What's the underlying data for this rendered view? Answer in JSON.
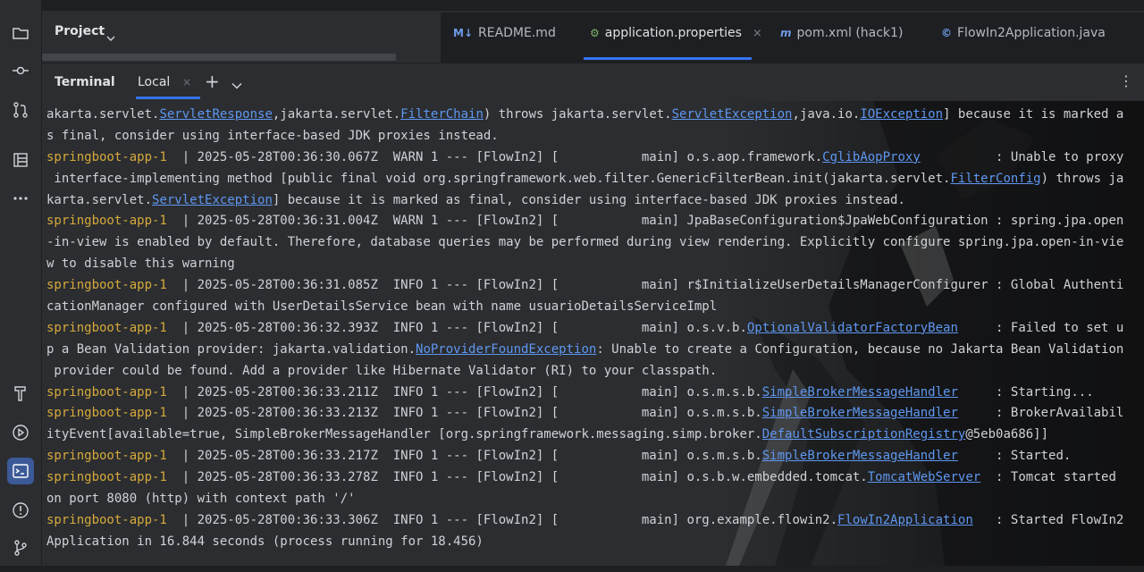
{
  "project": {
    "title": "Project"
  },
  "tabs": [
    {
      "icon": "M↓",
      "label": "README.md"
    },
    {
      "icon": "⚙",
      "label": "application.properties"
    },
    {
      "icon": "m",
      "label": "pom.xml (hack1)"
    },
    {
      "icon": "©",
      "label": "FlowIn2Application.java"
    }
  ],
  "terminal": {
    "title": "Terminal",
    "tab": "Local"
  },
  "log": [
    [
      {
        "t": "akarta.servlet."
      },
      {
        "t": "ServletResponse",
        "k": "lnk"
      },
      {
        "t": ",jakarta.servlet."
      },
      {
        "t": "FilterChain",
        "k": "lnk"
      },
      {
        "t": ") throws jakarta.servlet."
      },
      {
        "t": "ServletException",
        "k": "lnk"
      },
      {
        "t": ",java.io."
      },
      {
        "t": "IOException",
        "k": "lnk"
      },
      {
        "t": "] because it is marked a"
      }
    ],
    [
      {
        "t": "s final, consider using interface-based JDK proxies instead."
      }
    ],
    [
      {
        "t": "springboot-app-1 ",
        "k": "app"
      },
      {
        "t": " | 2025-05-28T00:36:30.067Z  WARN 1 --- [FlowIn2] [           main] o.s.aop.framework."
      },
      {
        "t": "CglibAopProxy",
        "k": "lnk"
      },
      {
        "t": "          : Unable to proxy"
      }
    ],
    [
      {
        "t": " interface-implementing method [public final void org.springframework.web.filter.GenericFilterBean.init(jakarta.servlet."
      },
      {
        "t": "FilterConfig",
        "k": "lnk"
      },
      {
        "t": ") throws ja"
      }
    ],
    [
      {
        "t": "karta.servlet."
      },
      {
        "t": "ServletException",
        "k": "lnk"
      },
      {
        "t": "] because it is marked as final, consider using interface-based JDK proxies instead."
      }
    ],
    [
      {
        "t": "springboot-app-1 ",
        "k": "app"
      },
      {
        "t": " | 2025-05-28T00:36:31.004Z  WARN 1 --- [FlowIn2] [           main] JpaBaseConfiguration$JpaWebConfiguration : spring.jpa.open"
      }
    ],
    [
      {
        "t": "-in-view is enabled by default. Therefore, database queries may be performed during view rendering. Explicitly configure spring.jpa.open-in-vie"
      }
    ],
    [
      {
        "t": "w to disable this warning"
      }
    ],
    [
      {
        "t": "springboot-app-1 ",
        "k": "app"
      },
      {
        "t": " | 2025-05-28T00:36:31.085Z  INFO 1 --- [FlowIn2] [           main] r$InitializeUserDetailsManagerConfigurer : Global Authenti"
      }
    ],
    [
      {
        "t": "cationManager configured with UserDetailsService bean with name usuarioDetailsServiceImpl"
      }
    ],
    [
      {
        "t": "springboot-app-1 ",
        "k": "app"
      },
      {
        "t": " | 2025-05-28T00:36:32.393Z  INFO 1 --- [FlowIn2] [           main] o.s.v.b."
      },
      {
        "t": "OptionalValidatorFactoryBean",
        "k": "lnk"
      },
      {
        "t": "     : Failed to set u"
      }
    ],
    [
      {
        "t": "p a Bean Validation provider: jakarta.validation."
      },
      {
        "t": "NoProviderFoundException",
        "k": "lnk"
      },
      {
        "t": ": Unable to create a Configuration, because no Jakarta Bean Validation"
      }
    ],
    [
      {
        "t": " provider could be found. Add a provider like Hibernate Validator (RI) to your classpath."
      }
    ],
    [
      {
        "t": "springboot-app-1 ",
        "k": "app"
      },
      {
        "t": " | 2025-05-28T00:36:33.211Z  INFO 1 --- [FlowIn2] [           main] o.s.m.s.b."
      },
      {
        "t": "SimpleBrokerMessageHandler",
        "k": "lnk"
      },
      {
        "t": "     : Starting..."
      }
    ],
    [
      {
        "t": "springboot-app-1 ",
        "k": "app"
      },
      {
        "t": " | 2025-05-28T00:36:33.213Z  INFO 1 --- [FlowIn2] [           main] o.s.m.s.b."
      },
      {
        "t": "SimpleBrokerMessageHandler",
        "k": "lnk"
      },
      {
        "t": "     : BrokerAvailabil"
      }
    ],
    [
      {
        "t": "ityEvent[available=true, SimpleBrokerMessageHandler [org.springframework.messaging.simp.broker."
      },
      {
        "t": "DefaultSubscriptionRegistry",
        "k": "lnk"
      },
      {
        "t": "@5eb0a686]]"
      }
    ],
    [
      {
        "t": "springboot-app-1 ",
        "k": "app"
      },
      {
        "t": " | 2025-05-28T00:36:33.217Z  INFO 1 --- [FlowIn2] [           main] o.s.m.s.b."
      },
      {
        "t": "SimpleBrokerMessageHandler",
        "k": "lnk"
      },
      {
        "t": "     : Started."
      }
    ],
    [
      {
        "t": "springboot-app-1 ",
        "k": "app"
      },
      {
        "t": " | 2025-05-28T00:36:33.278Z  INFO 1 --- [FlowIn2] [           main] o.s.b.w.embedded.tomcat."
      },
      {
        "t": "TomcatWebServer",
        "k": "lnk"
      },
      {
        "t": "  : Tomcat started"
      }
    ],
    [
      {
        "t": "on port 8080 (http) with context path '/'"
      }
    ],
    [
      {
        "t": "springboot-app-1 ",
        "k": "app"
      },
      {
        "t": " | 2025-05-28T00:36:33.306Z  INFO 1 --- [FlowIn2] [           main] org.example.flowin2."
      },
      {
        "t": "FlowIn2Application",
        "k": "lnk"
      },
      {
        "t": "   : Started FlowIn2"
      }
    ],
    [
      {
        "t": "Application in 16.844 seconds (process running for 18.456)"
      }
    ]
  ]
}
